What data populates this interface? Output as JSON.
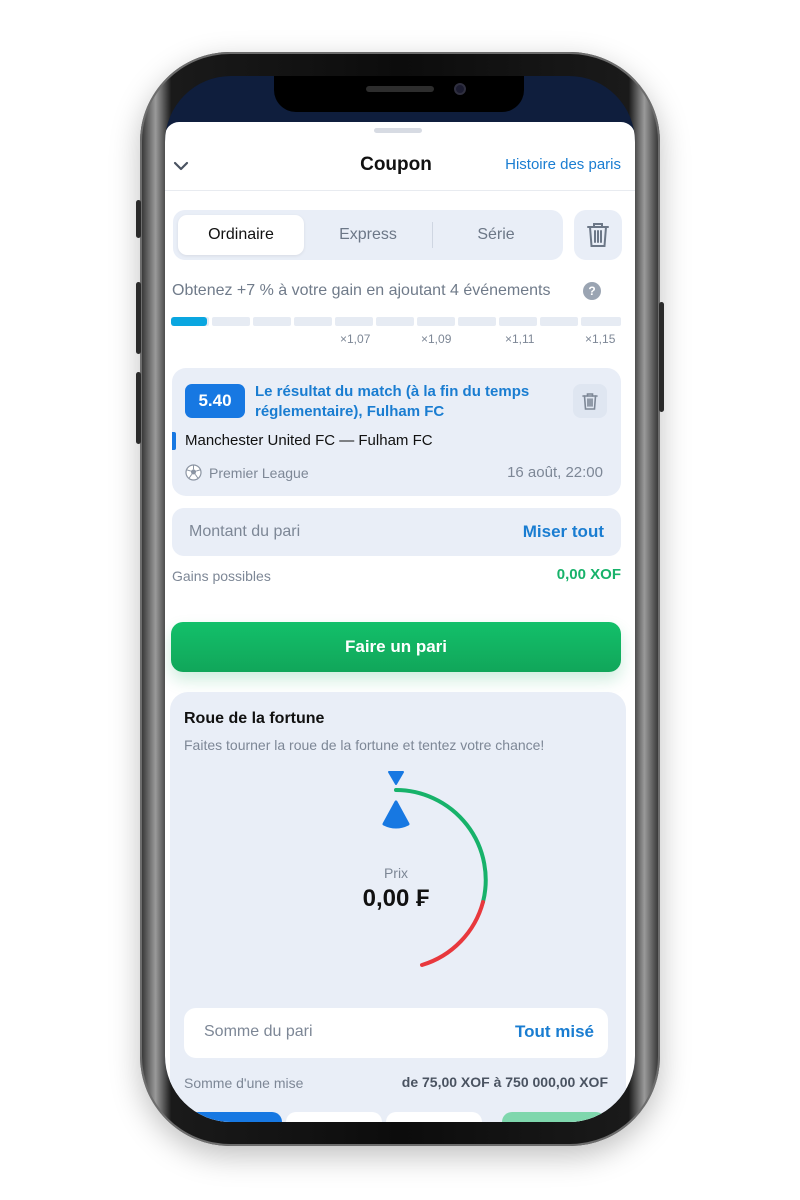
{
  "header": {
    "title": "Coupon",
    "history_link": "Histoire des paris"
  },
  "tabs": [
    {
      "label": "Ordinaire",
      "active": true
    },
    {
      "label": "Express",
      "active": false
    },
    {
      "label": "Série",
      "active": false
    }
  ],
  "promo": {
    "text": "Obtenez +7 % à votre gain en ajoutant 4 événements",
    "progress": 0.08,
    "multipliers": [
      "×1,07",
      "×1,09",
      "×1,11",
      "×1,15"
    ]
  },
  "bet": {
    "odds": "5.40",
    "selection": "Le résultat du match (à la fin du temps réglementaire), Fulham FC",
    "teams": "Manchester United FC — Fulham FC",
    "league": "Premier League",
    "date": "16 août, 22:00"
  },
  "stake": {
    "placeholder": "Montant du pari",
    "action": "Miser tout",
    "gains_label": "Gains possibles",
    "gains_value": "0,00 XOF"
  },
  "submit_label": "Faire un pari",
  "wheel": {
    "title": "Roue de la fortune",
    "subtitle": "Faites tourner la roue de la fortune et tentez votre chance!",
    "prize_label": "Prix",
    "prize_value": "0,00 ₣",
    "sum_placeholder": "Somme du pari",
    "sum_action": "Tout misé",
    "range_label": "Somme d'une mise",
    "range_value": "de 75,00 XOF à 750 000,00 XOF"
  },
  "colors": {
    "accent": "#1a7dd1",
    "primary_button": "#13c06a",
    "odds_badge": "#1778e2",
    "gains": "#17b26a",
    "arc_green": "#17b26a",
    "arc_red": "#e8383d"
  }
}
